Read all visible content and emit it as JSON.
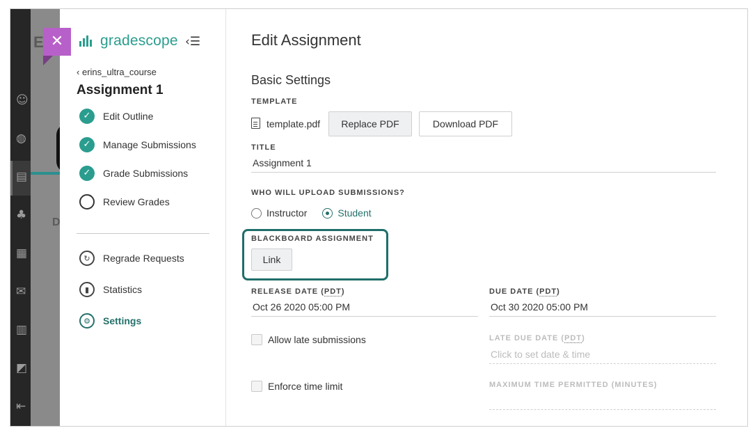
{
  "background": {
    "letters": [
      "E",
      "D"
    ]
  },
  "close_button": {
    "label": "✕"
  },
  "sidebar": {
    "brand": "gradescope",
    "collapse_icon": "‹☰",
    "breadcrumb": "erins_ultra_course",
    "breadcrumb_chevron": "‹",
    "assignment_title": "Assignment 1",
    "steps": [
      {
        "label": "Edit Outline",
        "done": true
      },
      {
        "label": "Manage Submissions",
        "done": true
      },
      {
        "label": "Grade Submissions",
        "done": true
      },
      {
        "label": "Review Grades",
        "done": false
      }
    ],
    "tools": [
      {
        "label": "Regrade Requests",
        "icon": "regrade-icon"
      },
      {
        "label": "Statistics",
        "icon": "statistics-icon"
      },
      {
        "label": "Settings",
        "icon": "settings-icon",
        "active": true
      }
    ]
  },
  "main": {
    "page_title": "Edit Assignment",
    "section_title": "Basic Settings",
    "template": {
      "label": "TEMPLATE",
      "file_name": "template.pdf",
      "replace_button": "Replace PDF",
      "download_button": "Download PDF"
    },
    "title_field": {
      "label": "TITLE",
      "value": "Assignment 1"
    },
    "uploaders": {
      "label": "WHO WILL UPLOAD SUBMISSIONS?",
      "options": [
        {
          "label": "Instructor",
          "selected": false
        },
        {
          "label": "Student",
          "selected": true
        }
      ]
    },
    "blackboard": {
      "label": "BLACKBOARD ASSIGNMENT",
      "link_button": "Link"
    },
    "release_date": {
      "label": "RELEASE DATE (",
      "tz": "PDT",
      "label_end": ")",
      "value": "Oct 26 2020 05:00 PM"
    },
    "due_date": {
      "label": "DUE DATE (",
      "tz": "PDT",
      "label_end": ")",
      "value": "Oct 30 2020 05:00 PM"
    },
    "late_submissions": {
      "label": "Allow late submissions",
      "checked": false
    },
    "late_due_date": {
      "label": "LATE DUE DATE (",
      "tz": "PDT",
      "label_end": ")",
      "placeholder": "Click to set date & time"
    },
    "time_limit": {
      "label": "Enforce time limit",
      "checked": false
    },
    "max_time": {
      "label": "MAXIMUM TIME PERMITTED (MINUTES)"
    }
  },
  "colors": {
    "brand": "#2a9d8f",
    "accent": "#24706a",
    "close": "#b860c9",
    "highlight": "#1f6e6a"
  }
}
